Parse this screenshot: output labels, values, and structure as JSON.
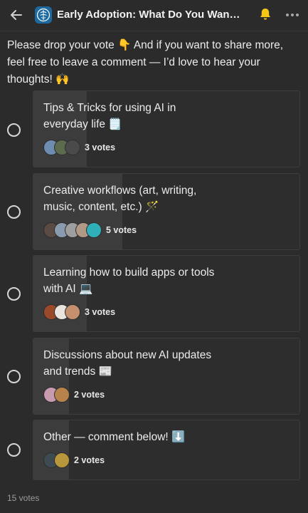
{
  "header": {
    "title": "Early Adoption: What Do You Want Most Fr…",
    "back_icon": "arrow-left-icon",
    "bell_icon": "bell-icon",
    "more_icon": "more-horizontal-icon"
  },
  "message": "Please drop your vote 👇 And if you want to share more, feel free to leave a comment — I’d love to hear your thoughts! 🙌",
  "options": [
    {
      "label": "Tips & Tricks for using AI in everyday life 🗒️",
      "votes_label": "3 votes",
      "votes": 3,
      "share": 0.2
    },
    {
      "label": "Creative workflows (art, writing, music, content, etc.) 🪄",
      "votes_label": "5 votes",
      "votes": 5,
      "share": 0.3333
    },
    {
      "label": "Learning how to build apps or tools with AI 💻",
      "votes_label": "3 votes",
      "votes": 3,
      "share": 0.2
    },
    {
      "label": "Discussions about new AI updates and trends 📰",
      "votes_label": "2 votes",
      "votes": 2,
      "share": 0.1333
    },
    {
      "label": "Other — comment below! ⬇️",
      "votes_label": "2 votes",
      "votes": 2,
      "share": 0.1333
    }
  ],
  "total_votes": "15 votes",
  "colors": {
    "accent_bell": "#f5c518",
    "background": "#2b2b2b",
    "progress_fill": "#3c3c3c"
  }
}
